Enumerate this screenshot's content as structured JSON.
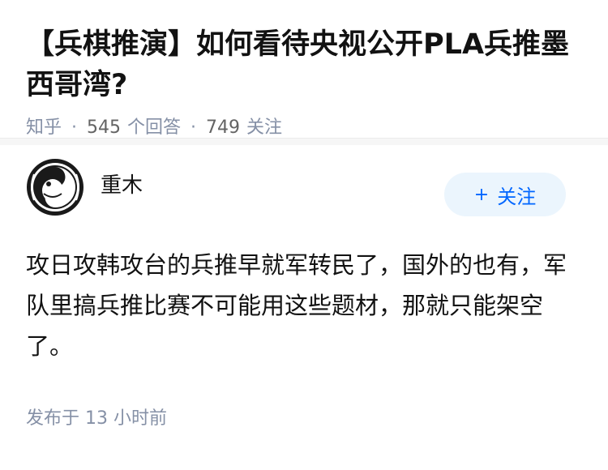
{
  "question": {
    "title": "【兵棋推演】如何看待央视公开PLA兵推墨西哥湾?",
    "source": "知乎",
    "separator": "·",
    "answers_count": "545",
    "answers_label": "个回答",
    "followers_count": "749",
    "followers_label": "关注"
  },
  "answer": {
    "author_name": "重木",
    "follow_plus": "+",
    "follow_label": "关注",
    "content": "攻日攻韩攻台的兵推早就军转民了，国外的也有，军队里搞兵推比赛不可能用这些题材，那就只能架空了。",
    "time_label": "发布于",
    "time_value": "13 小时前"
  },
  "colors": {
    "meta_gray": "#8590a6",
    "follow_blue": "#0066ff",
    "follow_bg": "#ebf5fd"
  },
  "icons": {
    "avatar": "yin-yang-portrait-avatar"
  }
}
